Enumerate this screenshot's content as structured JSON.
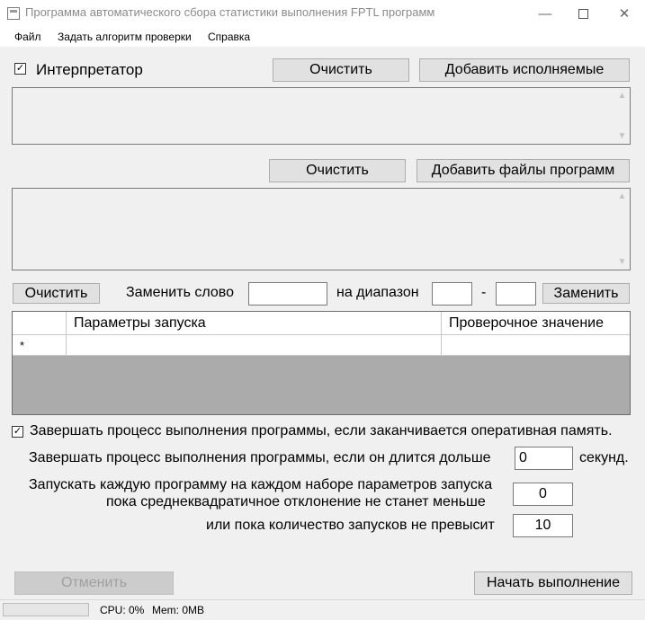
{
  "window": {
    "title": "Программа автоматического сбора статистики выполнения FPTL программ",
    "minimize_glyph": "—",
    "close_glyph": "✕"
  },
  "menu": {
    "items": [
      "Файл",
      "Задать алгоритм проверки",
      "Справка"
    ]
  },
  "interpreter_section": {
    "checkbox_checked": true,
    "checkbox_mark": "✓",
    "label": "Интерпретатор",
    "clear_button": "Очистить",
    "add_button": "Добавить исполняемые"
  },
  "programs_section": {
    "clear_button": "Очистить",
    "add_button": "Добавить файлы программ"
  },
  "scroll_arrows": {
    "up": "▲",
    "down": "▼"
  },
  "replace_row": {
    "clear_button": "Очистить",
    "replace_word_label": "Заменить слово",
    "replace_word_value": "",
    "range_label": "на диапазон",
    "range_from": "",
    "dash": "-",
    "range_to": "",
    "replace_button": "Заменить"
  },
  "grid": {
    "columns": [
      "",
      "Параметры запуска",
      "Проверочное значение"
    ],
    "new_row_marker": "*"
  },
  "options": {
    "kill_on_memory_checked": true,
    "kill_on_memory_mark": "✓",
    "kill_on_memory_label": "Завершать процесс выполнения программы, если заканчивается оперативная память.",
    "timeout_label": "Завершать процесс выполнения программы, если он длится дольше",
    "timeout_value": "0",
    "timeout_unit": "секунд.",
    "repeat_label_line1": "Запускать каждую программу на каждом наборе параметров запуска",
    "repeat_label_line2": "пока среднеквадратичное отклонение не станет меньше",
    "stddev_value": "0",
    "max_runs_label": "или пока количество запусков не превысит",
    "max_runs_value": "10"
  },
  "actions": {
    "cancel_button": "Отменить",
    "start_button": "Начать выполнение"
  },
  "status": {
    "progress_fraction": 0,
    "progress_color": "#06b025",
    "cpu": "CPU: 0%",
    "mem": "Mem: 0MB"
  }
}
